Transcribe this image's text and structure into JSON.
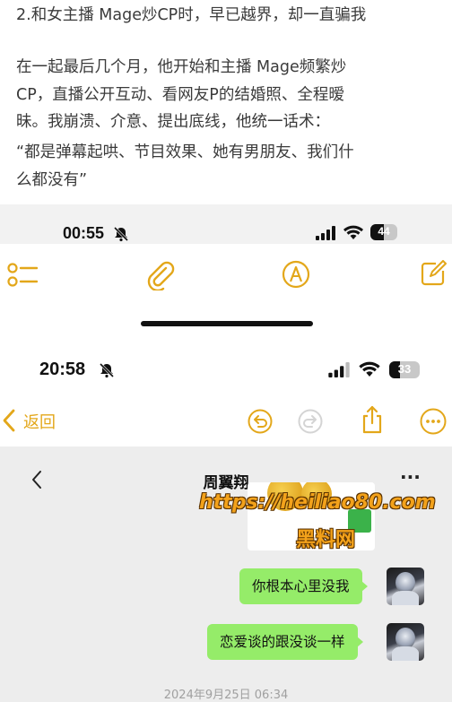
{
  "article": {
    "lines": [
      "2.和女主播 Mage炒CP时，早已越界，却一直骗我",
      "",
      "在一起最后几个月，他开始和主播 Mage频繁炒",
      "CP，直播公开互动、看网友P的结婚照、全程暧",
      "昧。我崩溃、介意、提出底线，他统一话术：",
      "“都是弹幕起哄、节目效果、她有男朋友、我们什",
      "么都没有”"
    ]
  },
  "statusbar1": {
    "time": "00:55",
    "battery": "44"
  },
  "notes_toolbar": {
    "icons": [
      "checklist-icon",
      "paperclip-icon",
      "markup-pen-icon",
      "compose-icon"
    ]
  },
  "statusbar2": {
    "time": "20:58",
    "battery": "33"
  },
  "nav": {
    "back_label": "返回"
  },
  "chat": {
    "title": "周翼翔",
    "more": "···",
    "messages": [
      {
        "text": "你根本心里没我"
      },
      {
        "text": "恋爱谈的跟没谈一样"
      }
    ],
    "timestamp": "2024年9月25日 06:34"
  },
  "watermark": {
    "url": "https://heiliao80.com",
    "text": "黑料网"
  },
  "colors": {
    "accent_yellow": "#e3a71a",
    "bubble_green": "#95ec69",
    "chat_bg": "#ededed"
  }
}
